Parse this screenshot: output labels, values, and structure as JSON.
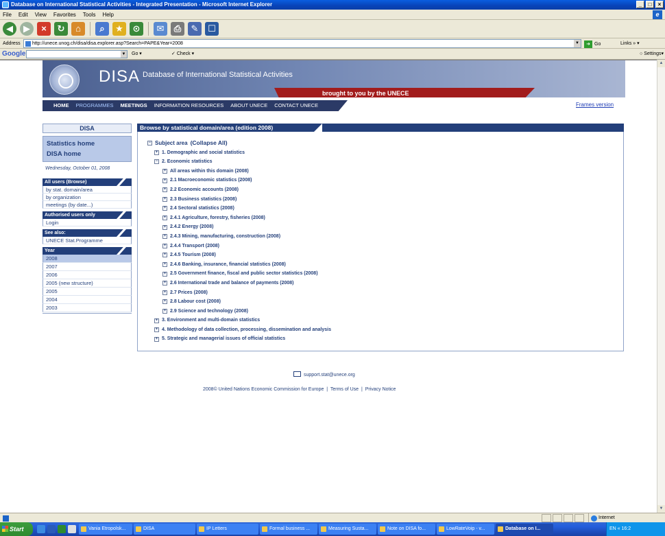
{
  "window": {
    "title": "Database on International Statistical Activities - Integrated Presentation - Microsoft Internet Explorer",
    "buttons": [
      "_",
      "□",
      "×"
    ]
  },
  "menu": [
    "File",
    "Edit",
    "View",
    "Favorites",
    "Tools",
    "Help"
  ],
  "address": {
    "label": "Address",
    "url": "http://unece.unog.ch/disa/disa.explorer.asp?Search=PAPE&Year=2008",
    "go": "Go",
    "links": "Links"
  },
  "googlebar": {
    "logo": "Google",
    "go": "Go",
    "check": "Check",
    "settings": "Settings"
  },
  "site": {
    "logo": "DISA",
    "subtitle": "Database of International Statistical Activities",
    "brought": "brought to you by the UNECE",
    "nav": [
      "HOME",
      "PROGRAMMES",
      "MEETINGS",
      "INFORMATION RESOURCES",
      "ABOUT UNECE",
      "CONTACT UNECE"
    ],
    "frames_version": "Frames version"
  },
  "sidebar": {
    "head": "DISA",
    "home_links": [
      "Statistics home",
      "DISA home"
    ],
    "date": "Wednesday, October 01, 2008",
    "all_users_title": "All users (Browse)",
    "all_users_links": [
      "by stat. domain/area",
      "by organization",
      "meetings (by date...)"
    ],
    "authorised_title": "Authorised users only",
    "authorised_links": [
      "Login"
    ],
    "see_also_title": "See also:",
    "see_also_links": [
      "UNECE Stat.Programme"
    ],
    "year_title": "Year",
    "years": [
      "2008",
      "2007",
      "2006",
      "2005 (new structure)",
      "2005",
      "2004",
      "2003"
    ]
  },
  "main": {
    "title": "Browse by statistical domain/area (edition 2008)",
    "subject_area": "Subject area",
    "collapse_all": "(Collapse All)",
    "level1": [
      "1. Demographic and social statistics",
      "2. Economic statistics",
      "3. Environment and multi-domain statistics",
      "4. Methodology of data collection, processing, dissemination and analysis",
      "5. Strategic and managerial issues of official statistics"
    ],
    "level2": [
      "All areas within this domain (2008)",
      "2.1 Macroeconomic statistics (2008)",
      "2.2 Economic accounts (2008)",
      "2.3 Business statistics (2008)",
      "2.4 Sectoral statistics (2008)",
      "2.4.1 Agriculture, forestry, fisheries (2008)",
      "2.4.2 Energy (2008)",
      "2.4.3 Mining, manufacturing, construction (2008)",
      "2.4.4 Transport (2008)",
      "2.4.5 Tourism (2008)",
      "2.4.6 Banking, insurance, financial statistics (2008)",
      "2.5 Government finance, fiscal and public sector statistics (2008)",
      "2.6 International trade and balance of payments (2008)",
      "2.7 Prices (2008)",
      "2.8 Labour cost (2008)",
      "2.9 Science and technology (2008)"
    ]
  },
  "footer": {
    "email": "support.stat@unece.org",
    "copyright": "2008© United Nations Economic Commission for Europe",
    "terms": "Terms of Use",
    "privacy": "Privacy Notice",
    "separator": "|"
  },
  "statusbar": {
    "zone": "Internet"
  },
  "taskbar": {
    "start": "Start",
    "tasks": [
      "Vania Etropolsk...",
      "DISA",
      "IP Letters",
      "Formal business ...",
      "Measuring Susta...",
      "Note on DISA fo...",
      "LowRateVoip - v...",
      "Database on I..."
    ],
    "tray": "EN « 16:2"
  }
}
